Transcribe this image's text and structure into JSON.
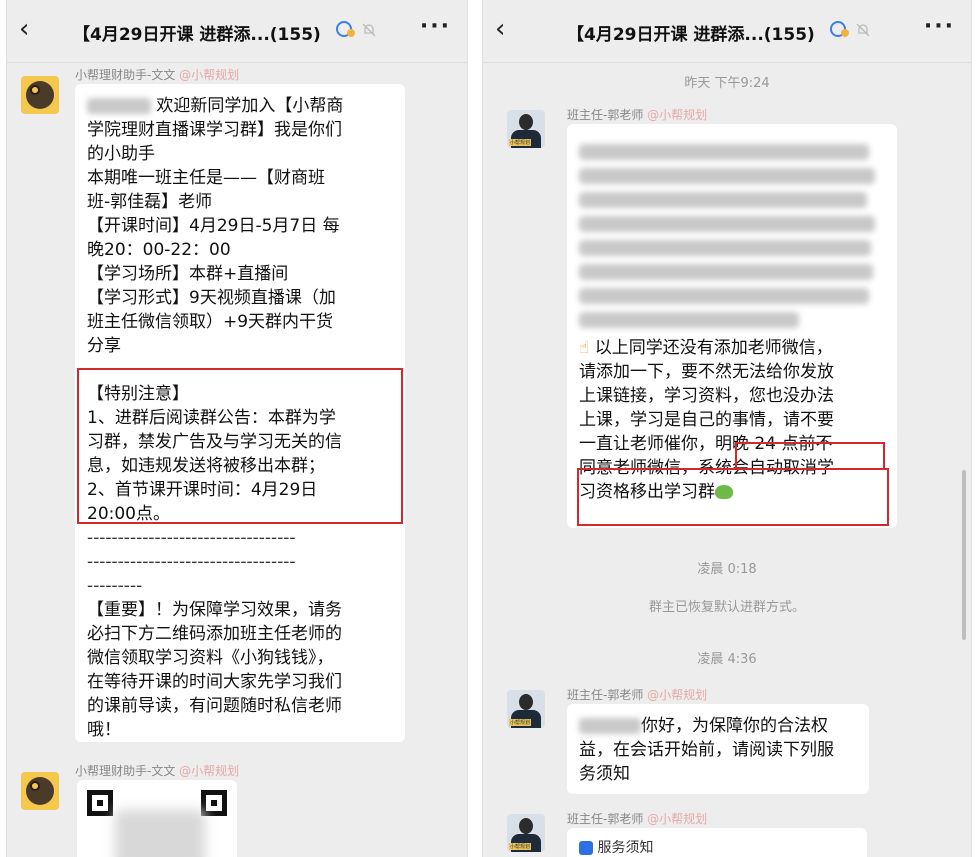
{
  "header": {
    "back_icon": "chevron-left-icon",
    "title": "【4月29日开课 进群添...(155)",
    "more_label": "···"
  },
  "left": {
    "msg1": {
      "sender": "小帮理财助手-文文",
      "sender_at": "@小帮规划",
      "line1_tail": "欢迎新同学加入【小帮商",
      "line2": "学院理财直播课学习群】我是你们",
      "line3": "的小助手",
      "line4": "本期唯一班主任是——【财商班",
      "line5": "班-郭佳磊】老师",
      "line6": "【开课时间】4月29日-5月7日 每",
      "line7": "晚20：00-22：00",
      "line8": "【学习场所】本群+直播间",
      "line9": "【学习形式】9天视频直播课（加",
      "line10": "班主任微信领取）+9天群内干货",
      "line11": "分享",
      "notice1": "【特别注意】",
      "notice2": "1、进群后阅读群公告：本群为学",
      "notice3": "习群，禁发广告及与学习无关的信",
      "notice4": "息，如违规发送将被移出本群；",
      "notice5": "2、首节课开课时间：4月29日",
      "notice6": "20:00点。",
      "dash1": "----------------------------------",
      "dash2": "----------------------------------",
      "dash3": "---------",
      "imp1": "【重要】！为保障学习效果，请务",
      "imp2": "必扫下方二维码添加班主任老师的",
      "imp3": "微信领取学习资料《小狗钱钱》，",
      "imp4": "在等待开课的时间大家先学习我们",
      "imp5": "的课前导读，有问题随时私信老师",
      "imp6": "哦！"
    },
    "msg2": {
      "sender": "小帮理财助手-文文",
      "sender_at": "@小帮规划"
    }
  },
  "right": {
    "time1": "昨天 下午9:24",
    "msg1": {
      "sender": "班主任-郭老师",
      "sender_at": "@小帮规划",
      "p1": "以上同学还没有添加老师微信，",
      "p2": "请添加一下，要不然无法给你发放",
      "p3": "上课链接，学习资料，您也没办法",
      "p4": "上课，学习是自己的事情，请不要",
      "p5a": "一直让老师催你，",
      "p5b": "明晚 24 点前不",
      "p6": "同意老师微信，系统会自动取消学",
      "p7": "习资格移出学习群"
    },
    "time2": "凌晨 0:18",
    "sys1": "群主已恢复默认进群方式。",
    "time3": "凌晨 4:36",
    "msg2": {
      "sender": "班主任-郭老师",
      "sender_at": "@小帮规划",
      "l1": "你好，为保障你的合法权",
      "l2": "益，在会话开始前，请阅读下列服",
      "l3": "务须知"
    },
    "msg3": {
      "sender": "班主任-郭老师",
      "sender_at": "@小帮规划",
      "card_title": "服务须知"
    }
  }
}
